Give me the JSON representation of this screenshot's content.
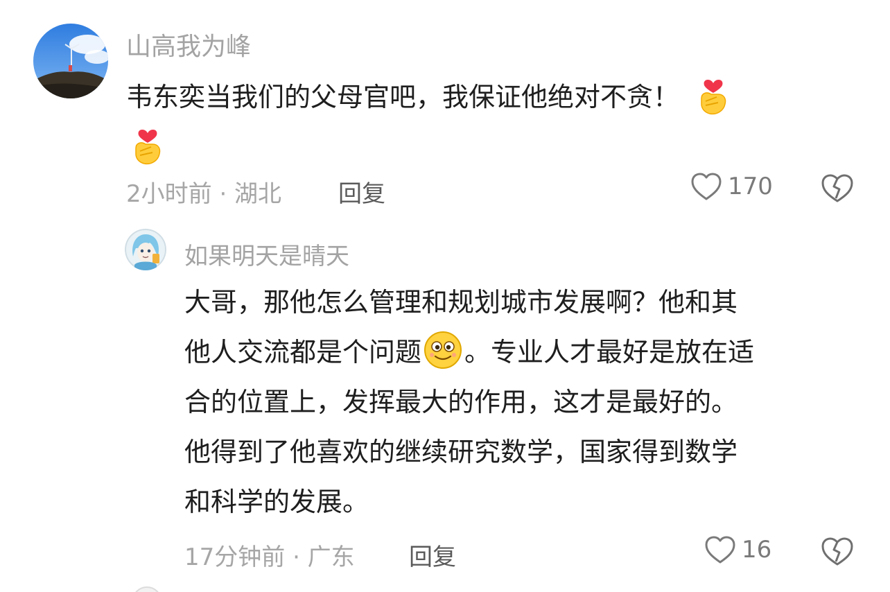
{
  "comments": [
    {
      "username": "山高我为峰",
      "text_line1": "韦东奕当我们的父母官吧，我保证他绝对不贪！",
      "emoji": "finger-heart-emoji",
      "time_location": "2小时前 · 湖北",
      "reply_label": "回复",
      "like_count": "170"
    }
  ],
  "replies": [
    {
      "username": "如果明天是晴天",
      "line1": "大哥，那他怎么管理和规划城市发展啊？他和其",
      "line2_a": "他人交流都是个问题",
      "line2_b": "。专业人才最好是放在适",
      "line3": "合的位置上，发挥最大的作用，这才是最好的。",
      "line4": "他得到了他喜欢的继续研究数学，国家得到数学",
      "line5": "和科学的发展。",
      "emoji": "smiling-face-emoji",
      "time_location": "17分钟前 · 广东",
      "reply_label": "回复",
      "like_count": "16"
    }
  ],
  "colors": {
    "username": "#a3a3a3",
    "meta": "#a6a6a6",
    "text": "#1e1e1e",
    "icon": "#7a7a7a"
  }
}
